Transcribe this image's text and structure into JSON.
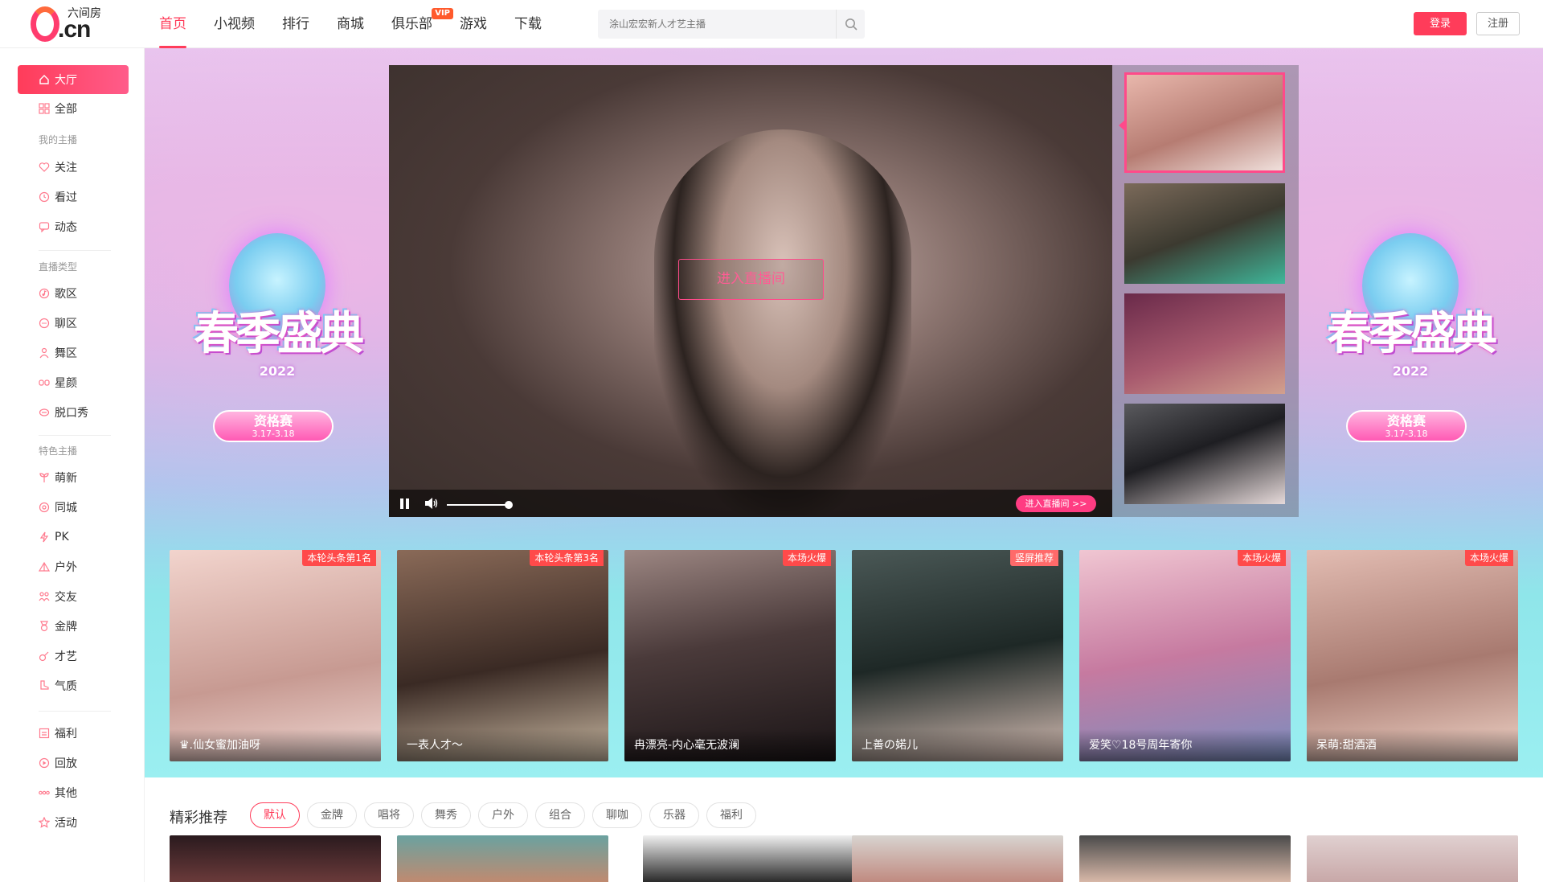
{
  "site": {
    "brand": "六间房",
    "logo_text": ".cn"
  },
  "nav": {
    "items": [
      {
        "label": "首页"
      },
      {
        "label": "小视频"
      },
      {
        "label": "排行"
      },
      {
        "label": "商城"
      },
      {
        "label": "俱乐部",
        "badge": "VIP"
      },
      {
        "label": "游戏"
      },
      {
        "label": "下载"
      }
    ],
    "active_index": 0
  },
  "search": {
    "placeholder": "涂山宏宏新人才艺主播"
  },
  "auth": {
    "login": "登录",
    "register": "注册"
  },
  "sidebar": {
    "top": [
      {
        "label": "大厅",
        "icon": "home-icon"
      },
      {
        "label": "全部",
        "icon": "grid-icon"
      }
    ],
    "my_header": "我的主播",
    "my": [
      {
        "label": "关注",
        "icon": "heart-icon"
      },
      {
        "label": "看过",
        "icon": "clock-icon"
      },
      {
        "label": "动态",
        "icon": "chat-icon"
      }
    ],
    "type_header": "直播类型",
    "types": [
      {
        "label": "歌区",
        "icon": "music-icon"
      },
      {
        "label": "聊区",
        "icon": "chat-icon"
      },
      {
        "label": "舞区",
        "icon": "dance-icon"
      },
      {
        "label": "星颜",
        "icon": "mask-icon"
      },
      {
        "label": "脱口秀",
        "icon": "mic-icon"
      }
    ],
    "feature_header": "特色主播",
    "features": [
      {
        "label": "萌新",
        "icon": "sprout-icon"
      },
      {
        "label": "同城",
        "icon": "location-icon"
      },
      {
        "label": "PK",
        "icon": "lightning-icon"
      },
      {
        "label": "户外",
        "icon": "mountain-icon"
      },
      {
        "label": "交友",
        "icon": "people-icon"
      },
      {
        "label": "金牌",
        "icon": "medal-icon"
      },
      {
        "label": "才艺",
        "icon": "guitar-icon"
      },
      {
        "label": "气质",
        "icon": "boot-icon"
      }
    ],
    "bottom": [
      {
        "label": "福利",
        "icon": "gift-icon"
      },
      {
        "label": "回放",
        "icon": "replay-icon"
      },
      {
        "label": "其他",
        "icon": "more-icon"
      },
      {
        "label": "活动",
        "icon": "star-icon"
      }
    ]
  },
  "promo": {
    "title": "春季盛典",
    "year": "2022",
    "pill": "资格赛",
    "dates": "3.17-3.18"
  },
  "player": {
    "enter_label": "进入直播间",
    "enter_small": "进入直播间 >>"
  },
  "cards": [
    {
      "tag": "本轮头条第1名",
      "name": "♛.仙女蜜加油呀",
      "c1": "#e9c9c0",
      "c2": "#b28b84"
    },
    {
      "tag": "本轮头条第3名",
      "name": "一表人才～",
      "c1": "#6c4a3a",
      "c2": "#2a1f1a"
    },
    {
      "tag": "本场火爆",
      "name": "冉漂亮-内心毫无波澜",
      "c1": "#8c7570",
      "c2": "#2e2426"
    },
    {
      "tag": "竖屏推荐",
      "name": "上善の婼儿",
      "c1": "#3c4846",
      "c2": "#1b2321"
    },
    {
      "tag": "本场火爆",
      "name": "爱笑♡18号周年寄你",
      "c1": "#e7aac0",
      "c2": "#8a96b8"
    },
    {
      "tag": "本场火爆",
      "name": "呆萌:甜酒酒",
      "c1": "#d6a8a0",
      "c2": "#7a5c56"
    }
  ],
  "recommend": {
    "title": "精彩推荐",
    "filters": [
      "默认",
      "金牌",
      "唱将",
      "舞秀",
      "户外",
      "组合",
      "聊咖",
      "乐器",
      "福利"
    ],
    "active_filter": 0
  },
  "colors": {
    "accent": "#ff3c5a",
    "hero_pink": "#e6c6ef",
    "hero_cyan": "#9beff1"
  }
}
